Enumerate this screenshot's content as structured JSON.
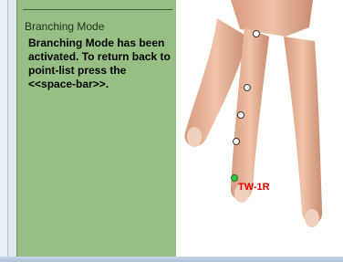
{
  "panel": {
    "title": "Branching Mode",
    "message": "Branching Mode has been activated. To return back to point-list press the <<space-bar>>."
  },
  "viewport": {
    "active_point_label": "TW-1R",
    "colors": {
      "skin": "#e8b497",
      "skin_shadow": "#c98c6f",
      "active_point": "#2ecc40",
      "label": "#e60000"
    },
    "points": [
      {
        "icon": "white-circle",
        "active": false
      },
      {
        "icon": "white-circle",
        "active": false
      },
      {
        "icon": "white-circle",
        "active": false
      },
      {
        "icon": "white-circle",
        "active": false
      },
      {
        "icon": "green-circle",
        "active": true
      }
    ]
  }
}
